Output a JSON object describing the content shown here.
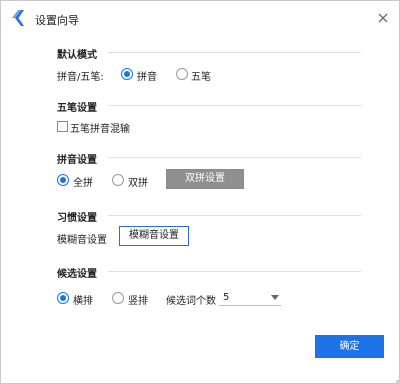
{
  "window": {
    "title": "设置向导"
  },
  "sections": {
    "default_mode": {
      "title": "默认模式",
      "row_label": "拼音/五笔:",
      "options": [
        {
          "label": "拼音",
          "checked": true
        },
        {
          "label": "五笔",
          "checked": false
        }
      ]
    },
    "wubi": {
      "title": "五笔设置",
      "checkbox_label": "五笔拼音混输",
      "checked": false
    },
    "pinyin": {
      "title": "拼音设置",
      "options": [
        {
          "label": "全拼",
          "checked": true
        },
        {
          "label": "双拼",
          "checked": false
        }
      ],
      "button_label": "双拼设置"
    },
    "habit": {
      "title": "习惯设置",
      "row_label": "模糊音设置",
      "button_label": "模糊音设置"
    },
    "candidates": {
      "title": "候选设置",
      "options": [
        {
          "label": "横排",
          "checked": true
        },
        {
          "label": "竖排",
          "checked": false
        }
      ],
      "count_label": "候选词个数",
      "count_value": "5"
    }
  },
  "footer": {
    "confirm_label": "确定"
  },
  "colors": {
    "accent": "#1d72e8",
    "logo": "#2f6fe0",
    "disabled_button": "#8f8f8f"
  },
  "icons": {
    "logo": "app-logo-icon",
    "close": "close-icon",
    "dropdown": "chevron-down-icon"
  }
}
